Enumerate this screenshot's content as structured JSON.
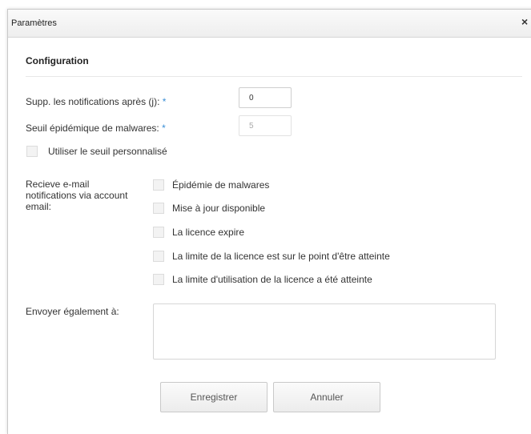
{
  "dialog": {
    "title": "Paramètres",
    "close_label": "×"
  },
  "section": {
    "title": "Configuration"
  },
  "fields": {
    "delete_notifications": {
      "label": "Supp. les notifications après (j):",
      "required_marker": "*",
      "value": "0"
    },
    "malware_threshold": {
      "label": "Seuil épidémique de malwares:",
      "required_marker": "*",
      "value": "5",
      "disabled": true
    },
    "custom_threshold": {
      "label": "Utiliser le seuil personnalisé",
      "checked": false
    }
  },
  "email_notifications": {
    "label_line1": "Recieve e-mail",
    "label_line2": "notifications via account",
    "label_line3": "email:",
    "options": [
      {
        "label": "Épidémie de malwares",
        "checked": false
      },
      {
        "label": "Mise à jour disponible",
        "checked": false
      },
      {
        "label": "La licence expire",
        "checked": false
      },
      {
        "label": "La limite de la licence est sur le point d'être atteinte",
        "checked": false
      },
      {
        "label": "La limite d'utilisation de la licence a été atteinte",
        "checked": false
      }
    ]
  },
  "also_send": {
    "label": "Envoyer également à:",
    "value": ""
  },
  "buttons": {
    "save": "Enregistrer",
    "cancel": "Annuler"
  },
  "colors": {
    "required_marker": "#3a8fd6",
    "titlebar": "#eeeeee"
  }
}
